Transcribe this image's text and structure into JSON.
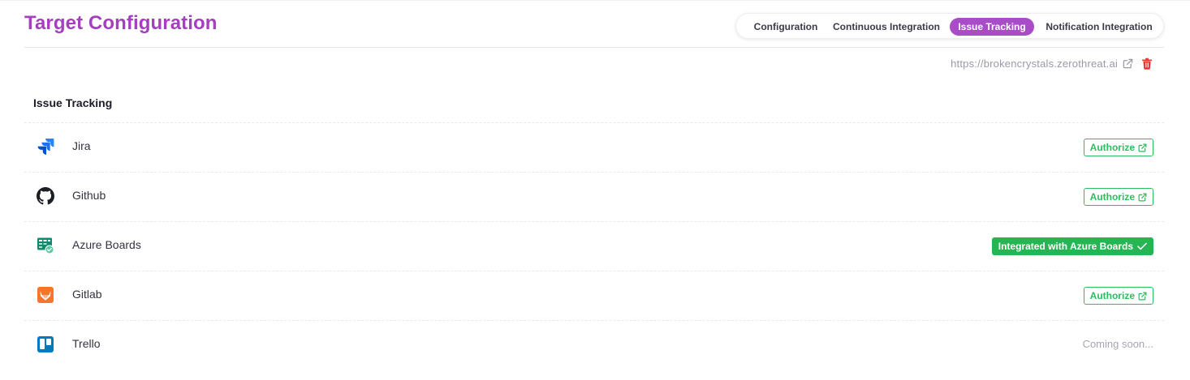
{
  "page": {
    "title": "Target Configuration",
    "url": "https://brokencrystals.zerothreat.ai"
  },
  "tabs": [
    {
      "label": "Configuration",
      "active": false
    },
    {
      "label": "Continuous Integration",
      "active": false
    },
    {
      "label": "Issue Tracking",
      "active": true
    },
    {
      "label": "Notification Integration",
      "active": false
    }
  ],
  "section": {
    "title": "Issue Tracking"
  },
  "integrations": [
    {
      "name": "Jira",
      "icon": "jira-icon",
      "status": "authorize",
      "action_label": "Authorize"
    },
    {
      "name": "Github",
      "icon": "github-icon",
      "status": "authorize",
      "action_label": "Authorize"
    },
    {
      "name": "Azure Boards",
      "icon": "azure-boards-icon",
      "status": "integrated",
      "action_label": "Integrated with Azure Boards"
    },
    {
      "name": "Gitlab",
      "icon": "gitlab-icon",
      "status": "authorize",
      "action_label": "Authorize"
    },
    {
      "name": "Trello",
      "icon": "trello-icon",
      "status": "coming-soon",
      "action_label": "Coming soon..."
    }
  ],
  "colors": {
    "title": "#a43fc0",
    "active_tab": "#a94cc7",
    "success": "#2ebd5f",
    "danger": "#e53935"
  }
}
